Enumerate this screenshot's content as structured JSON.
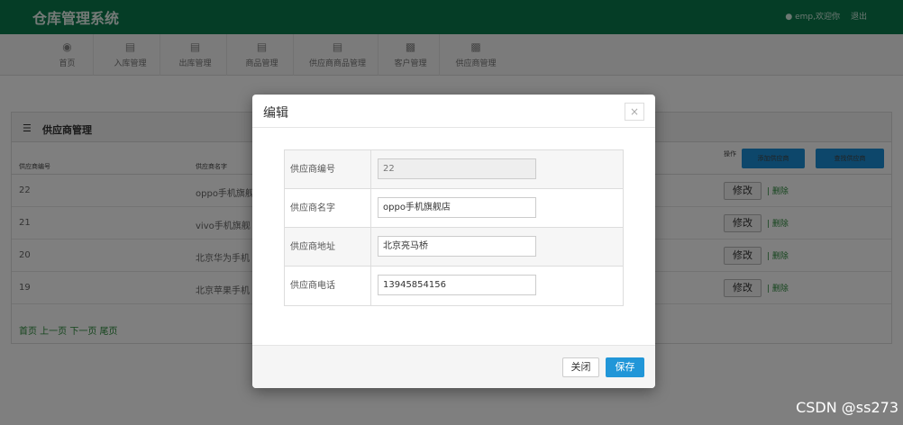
{
  "header": {
    "brand": "仓库管理系统",
    "user": "emp,欢迎你",
    "logout": "退出"
  },
  "nav": [
    {
      "label": "首页",
      "icon": "dashboard-icon"
    },
    {
      "label": "入库管理",
      "icon": "bar-chart-icon"
    },
    {
      "label": "出库管理",
      "icon": "bar-chart-icon"
    },
    {
      "label": "商品管理",
      "icon": "bar-chart-icon"
    },
    {
      "label": "供应商商品管理",
      "icon": "bar-chart-icon"
    },
    {
      "label": "客户管理",
      "icon": "sitemap-icon"
    },
    {
      "label": "供应商管理",
      "icon": "sitemap-icon"
    }
  ],
  "panel": {
    "title": "供应商管理",
    "columns": {
      "id": "供应商编号",
      "name": "供应商名字",
      "ops": "操作"
    },
    "add_button": "添加供应商",
    "find_button": "查找供应商",
    "rows": [
      {
        "id": "22",
        "name": "oppo手机旗舰"
      },
      {
        "id": "21",
        "name": "vivo手机旗舰"
      },
      {
        "id": "20",
        "name": "北京华为手机"
      },
      {
        "id": "19",
        "name": "北京苹果手机"
      }
    ],
    "edit_label": "修改",
    "delete_label": "删除",
    "pager": "首页 上一页 下一页 尾页"
  },
  "modal": {
    "title": "编辑",
    "close_icon": "×",
    "fields": [
      {
        "label": "供应商编号",
        "value": "22",
        "readonly": true
      },
      {
        "label": "供应商名字",
        "value": "oppo手机旗舰店",
        "readonly": false
      },
      {
        "label": "供应商地址",
        "value": "北京亮马桥",
        "readonly": false
      },
      {
        "label": "供应商电话",
        "value": "13945854156",
        "readonly": false
      }
    ],
    "close_button": "关闭",
    "save_button": "保存"
  },
  "watermark": "CSDN @ss273",
  "colors": {
    "topbar": "#0a7a4c",
    "primary": "#2196d8"
  }
}
